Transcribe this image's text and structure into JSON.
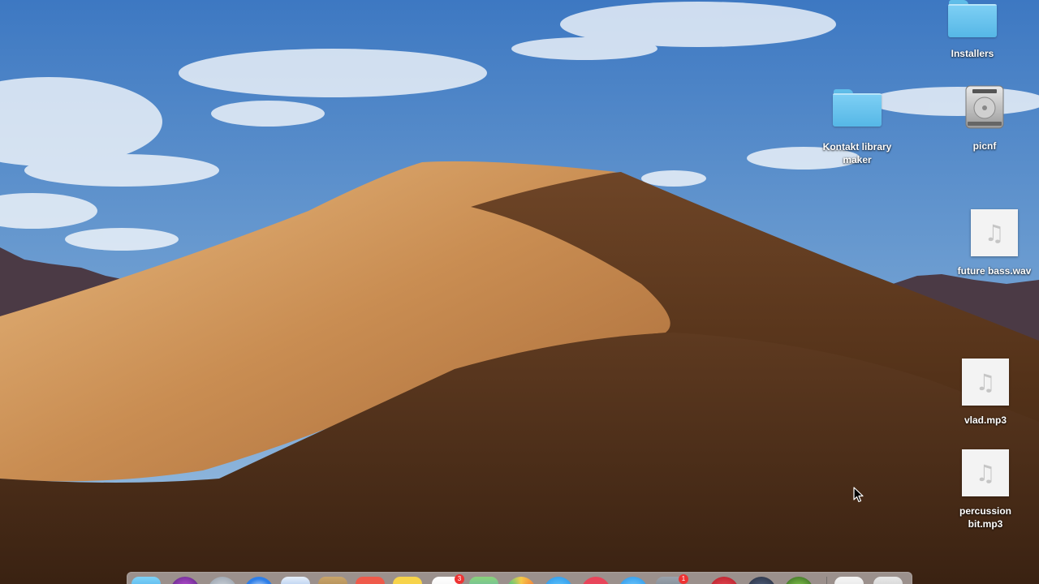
{
  "desktop": {
    "icons": [
      {
        "type": "folder",
        "label": "Installers"
      },
      {
        "type": "folder",
        "label": "Kontakt library maker"
      },
      {
        "type": "disk",
        "label": "picnf"
      },
      {
        "type": "audio",
        "label": "future bass.wav"
      },
      {
        "type": "audio",
        "label": "vlad.mp3"
      },
      {
        "type": "audio",
        "label": "percussion bit.mp3"
      }
    ],
    "music_glyph": "♫"
  },
  "dock": {
    "items": [
      {
        "name": "finder"
      },
      {
        "name": "siri"
      },
      {
        "name": "launchpad"
      },
      {
        "name": "safari"
      },
      {
        "name": "mail"
      },
      {
        "name": "contacts"
      },
      {
        "name": "calendar"
      },
      {
        "name": "notes"
      },
      {
        "name": "reminders"
      },
      {
        "name": "maps"
      },
      {
        "name": "photos"
      },
      {
        "name": "messages"
      },
      {
        "name": "itunes"
      },
      {
        "name": "app-store"
      },
      {
        "name": "system-preferences"
      },
      {
        "name": "app-red"
      },
      {
        "name": "app-dark"
      },
      {
        "name": "app-green"
      },
      {
        "name": "documents"
      },
      {
        "name": "trash"
      }
    ],
    "badges": {
      "calendar": "3",
      "system-preferences": "1"
    }
  }
}
